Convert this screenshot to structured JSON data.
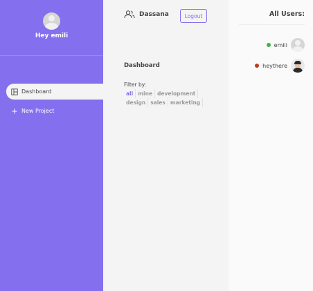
{
  "sidebar": {
    "greeting": "Hey emili",
    "nav": [
      {
        "label": "Dashboard",
        "icon": "dashboard-icon",
        "active": true
      },
      {
        "label": "New Project",
        "icon": "plus-icon",
        "active": false
      }
    ]
  },
  "header": {
    "brand": "Dassana",
    "brand_icon": "users-icon",
    "logout_label": "Logout"
  },
  "main": {
    "title": "Dashboard",
    "filter_label": "Filter by:",
    "filters": [
      "all",
      "mine",
      "development",
      "design",
      "sales",
      "marketing"
    ],
    "active_filter": "all"
  },
  "users_panel": {
    "title": "All Users:",
    "users": [
      {
        "name": "emili",
        "status_color": "#3cb54a"
      },
      {
        "name": "heythere",
        "status_color": "#c0391b"
      }
    ]
  },
  "colors": {
    "accent": "#8470ee",
    "online": "#3cb54a",
    "offline": "#c0391b"
  }
}
